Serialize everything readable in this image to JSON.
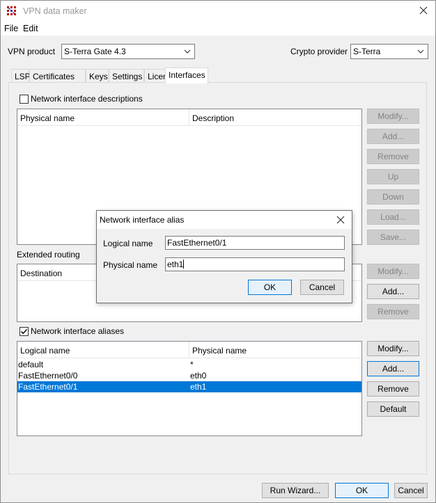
{
  "window": {
    "title": "VPN data maker"
  },
  "menu": {
    "file": "File",
    "edit": "Edit"
  },
  "top": {
    "vpn_product_label": "VPN product",
    "vpn_product_value": "S-Terra Gate 4.3",
    "crypto_provider_label": "Crypto provider",
    "crypto_provider_value": "S-Terra"
  },
  "tabs": [
    "LSP",
    "Certificates",
    "Keys",
    "Settings",
    "License",
    "Interfaces"
  ],
  "active_tab": "Interfaces",
  "descriptions": {
    "checkbox_label": "Network interface descriptions",
    "checked": false,
    "columns": [
      "Physical name",
      "Description"
    ],
    "buttons": [
      "Modify...",
      "Add...",
      "Remove",
      "Up",
      "Down",
      "Load...",
      "Save..."
    ]
  },
  "routing": {
    "label": "Extended routing",
    "columns": [
      "Destination"
    ],
    "buttons": [
      "Modify...",
      "Add...",
      "Remove"
    ]
  },
  "aliases": {
    "checkbox_label": "Network interface aliases",
    "checked": true,
    "columns": [
      "Logical name",
      "Physical name"
    ],
    "rows": [
      {
        "logical": "default",
        "physical": "*"
      },
      {
        "logical": "FastEthernet0/0",
        "physical": "eth0"
      },
      {
        "logical": "FastEthernet0/1",
        "physical": "eth1"
      }
    ],
    "selected_row": "FastEthernet0/1",
    "buttons": [
      "Modify...",
      "Add...",
      "Remove",
      "Default"
    ]
  },
  "bottom": {
    "run_wizard": "Run Wizard...",
    "ok": "OK",
    "cancel": "Cancel"
  },
  "dialog": {
    "title": "Network interface alias",
    "logical_label": "Logical name",
    "logical_value": "FastEthernet0/1",
    "physical_label": "Physical name",
    "physical_value": "eth1",
    "ok": "OK",
    "cancel": "Cancel"
  },
  "colors": {
    "selection": "#0078d7",
    "focus_border": "#0078d7"
  }
}
